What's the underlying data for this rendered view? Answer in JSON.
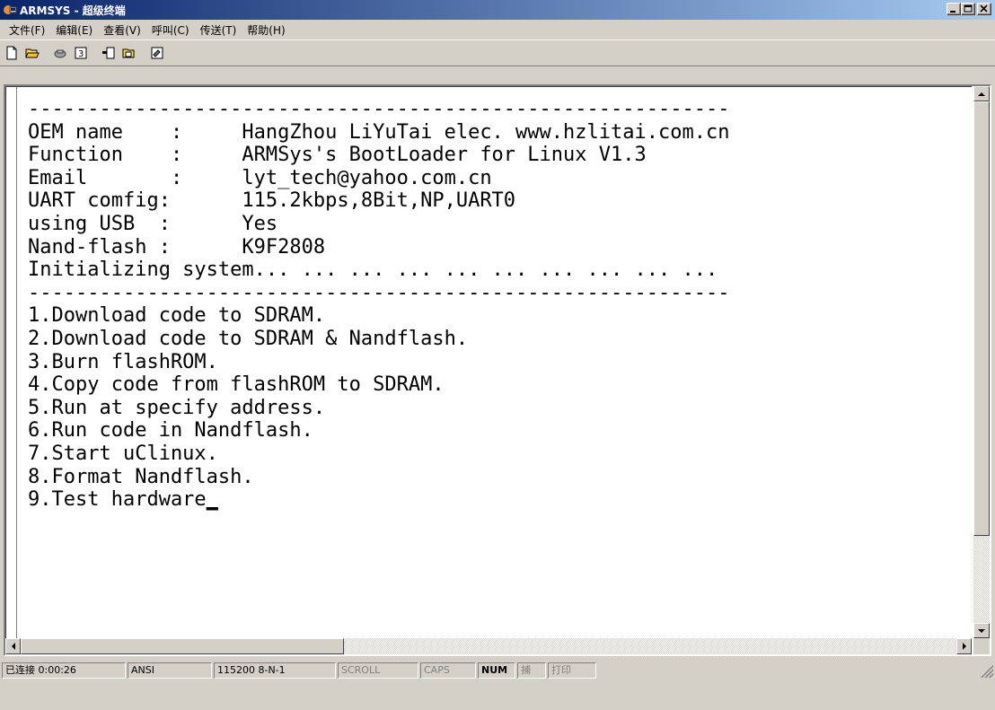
{
  "window": {
    "title": "ARMSYS - 超级终端",
    "icon": "hyperterminal-icon"
  },
  "menu": [
    {
      "label": "文件(F)"
    },
    {
      "label": "编辑(E)"
    },
    {
      "label": "查看(V)"
    },
    {
      "label": "呼叫(C)"
    },
    {
      "label": "传送(T)"
    },
    {
      "label": "帮助(H)"
    }
  ],
  "toolbar": {
    "buttons": [
      "new-icon",
      "open-icon",
      "disconnect-icon",
      "dial-icon",
      "send-icon",
      "receive-icon",
      "properties-icon"
    ]
  },
  "terminal": {
    "lines": [
      "-----------------------------------------------------------",
      "OEM name    :     HangZhou LiYuTai elec. www.hzlitai.com.cn",
      "Function    :     ARMSys's BootLoader for Linux V1.3",
      "Email       :     lyt_tech@yahoo.com.cn",
      "UART comfig:      115.2kbps,8Bit,NP,UART0",
      "using USB  :      Yes",
      "Nand-flash :      K9F2808",
      "Initializing system... ... ... ... ... ... ... ... ... ...",
      "-----------------------------------------------------------",
      "1.Download code to SDRAM.",
      "2.Download code to SDRAM & Nandflash.",
      "3.Burn flashROM.",
      "4.Copy code from flashROM to SDRAM.",
      "5.Run at specify address.",
      "6.Run code in Nandflash.",
      "7.Start uClinux.",
      "8.Format Nandflash.",
      "9.Test hardware"
    ],
    "cursor": "_"
  },
  "status": {
    "connected": "已连接 0:00:26",
    "emulation": "ANSI",
    "port": "115200 8-N-1",
    "scroll": "SCROLL",
    "caps": "CAPS",
    "num": "NUM",
    "capture": "捕",
    "print": "打印"
  }
}
